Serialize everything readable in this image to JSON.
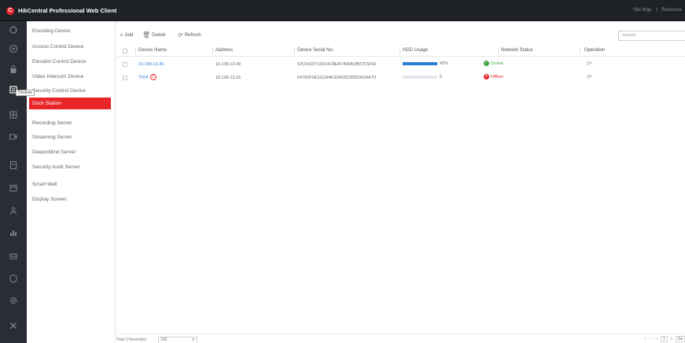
{
  "app": {
    "title": "HikCentral Professional Web Client",
    "logo_glyph": "C",
    "top_right": [
      "Site Map",
      "|",
      "Resource"
    ]
  },
  "rail": {
    "tooltip": "Devices",
    "icons": [
      "home-icon",
      "target-icon",
      "lock-icon",
      "device-icon",
      "grid-icon",
      "video-icon",
      "document-icon",
      "calendar-icon",
      "person-icon",
      "chart-icon",
      "server-icon",
      "shield-icon",
      "settings-icon",
      "tools-icon"
    ]
  },
  "subnav": {
    "items": [
      {
        "label": "Encoding Device",
        "active": false
      },
      {
        "label": "Access Control Device",
        "active": false
      },
      {
        "label": "Elevator Control Device",
        "active": false
      },
      {
        "label": "Video Intercom Device",
        "active": false
      },
      {
        "label": "Security Control Device",
        "active": false
      },
      {
        "label": "Dock Station",
        "active": true
      },
      {
        "label": "Recording Server",
        "active": false
      },
      {
        "label": "Streaming Server",
        "active": false
      },
      {
        "label": "DeepinMind Server",
        "active": false
      },
      {
        "label": "Security Audit Server",
        "active": false
      },
      {
        "label": "Smart Wall",
        "active": false
      },
      {
        "label": "Display Screen",
        "active": false
      }
    ]
  },
  "toolbar": {
    "add": "Add",
    "delete": "Delete",
    "refresh": "Refresh",
    "search_placeholder": "Search"
  },
  "table": {
    "columns": [
      "Device Name",
      "Address",
      "Device Serial No.",
      "HDD Usage",
      "Network Status",
      "Operation"
    ],
    "rows": [
      {
        "name": "10.199.13.49",
        "address": "10.199.13.49",
        "serial": "52C5420710014C8EA7495ADB57F5F82",
        "hdd_fraction": 1.0,
        "hdd_label": "42%",
        "status": "Online",
        "status_ok": true
      },
      {
        "name": "Tesst",
        "address": "10.199.13.16",
        "serial": "64782F0E31CA4E32A02D36563934A70",
        "hdd_fraction": 0.0,
        "hdd_label": "0",
        "status": "Offline",
        "status_ok": false
      }
    ]
  },
  "footer": {
    "total": "Total 2 Record(s)",
    "page_size": "100",
    "page": "1",
    "page_total": "/1",
    "goto": "Go"
  },
  "colors": {
    "accent": "#e8262a",
    "link": "#2d7fd4",
    "online": "#3da63d",
    "offline": "#e8262a"
  }
}
